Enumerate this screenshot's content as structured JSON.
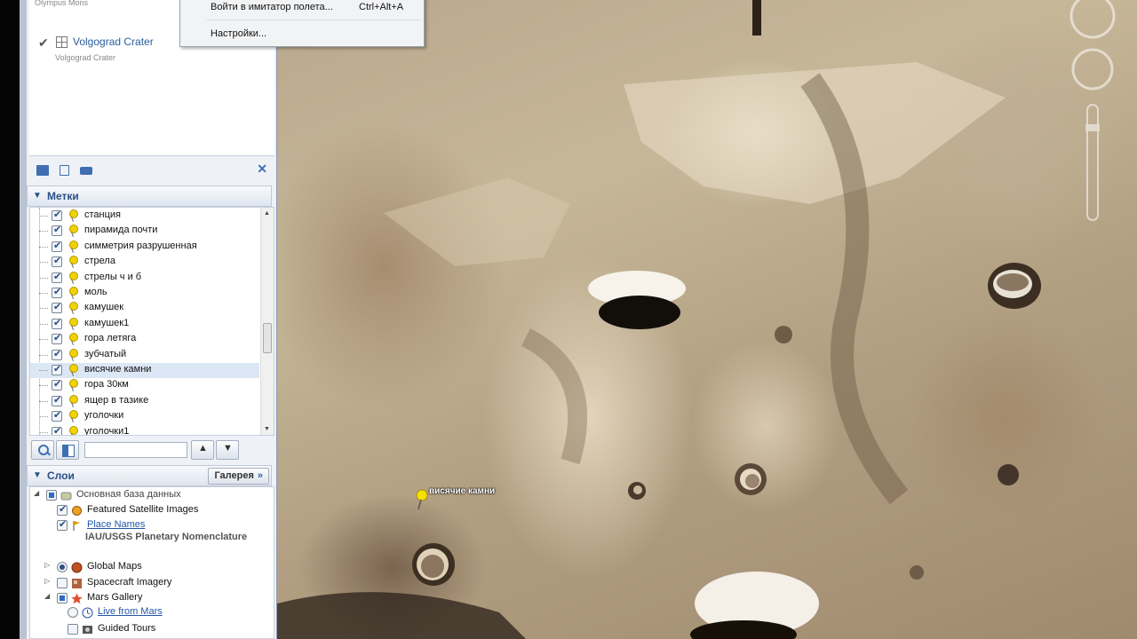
{
  "search": {
    "previous_result": "Olympus Mons",
    "result_title": "Volgograd Crater",
    "result_subtitle": "Volgograd Crater"
  },
  "menu": {
    "items": [
      {
        "label": "Войти в имитатор полета...",
        "shortcut": "Ctrl+Alt+A"
      },
      {
        "label": "Настройки...",
        "shortcut": ""
      }
    ]
  },
  "places": {
    "header": "Метки",
    "items": [
      {
        "label": "станция",
        "checked": true
      },
      {
        "label": "пирамида почти",
        "checked": true
      },
      {
        "label": "симметрия разрушенная",
        "checked": true
      },
      {
        "label": "стрела",
        "checked": true
      },
      {
        "label": "стрелы ч и б",
        "checked": true
      },
      {
        "label": "моль",
        "checked": true
      },
      {
        "label": "камушек",
        "checked": true
      },
      {
        "label": "камушек1",
        "checked": true
      },
      {
        "label": "гора летяга",
        "checked": true
      },
      {
        "label": "зубчатый",
        "checked": true
      },
      {
        "label": "висячие камни",
        "checked": true,
        "selected": true
      },
      {
        "label": "гора 30км",
        "checked": true
      },
      {
        "label": "ящер в тазике",
        "checked": true
      },
      {
        "label": "уголочки",
        "checked": true
      },
      {
        "label": "уголочки1",
        "checked": true
      }
    ]
  },
  "layers": {
    "header": "Слои",
    "gallery_button": "Галерея",
    "primary_db": "Основная база данных",
    "featured": "Featured Satellite Images",
    "place_names": "Place Names",
    "place_names_sub": "IAU/USGS Planetary Nomenclature",
    "global_maps": "Global Maps",
    "spacecraft": "Spacecraft Imagery",
    "mars_gallery": "Mars Gallery",
    "live_from_mars": "Live from Mars",
    "guided_tours": "Guided Tours"
  },
  "map": {
    "pin_label": "висячие камни"
  },
  "colors": {
    "accent": "#2a4f86",
    "link": "#2456a8",
    "selected_row": "#dce7f5"
  }
}
